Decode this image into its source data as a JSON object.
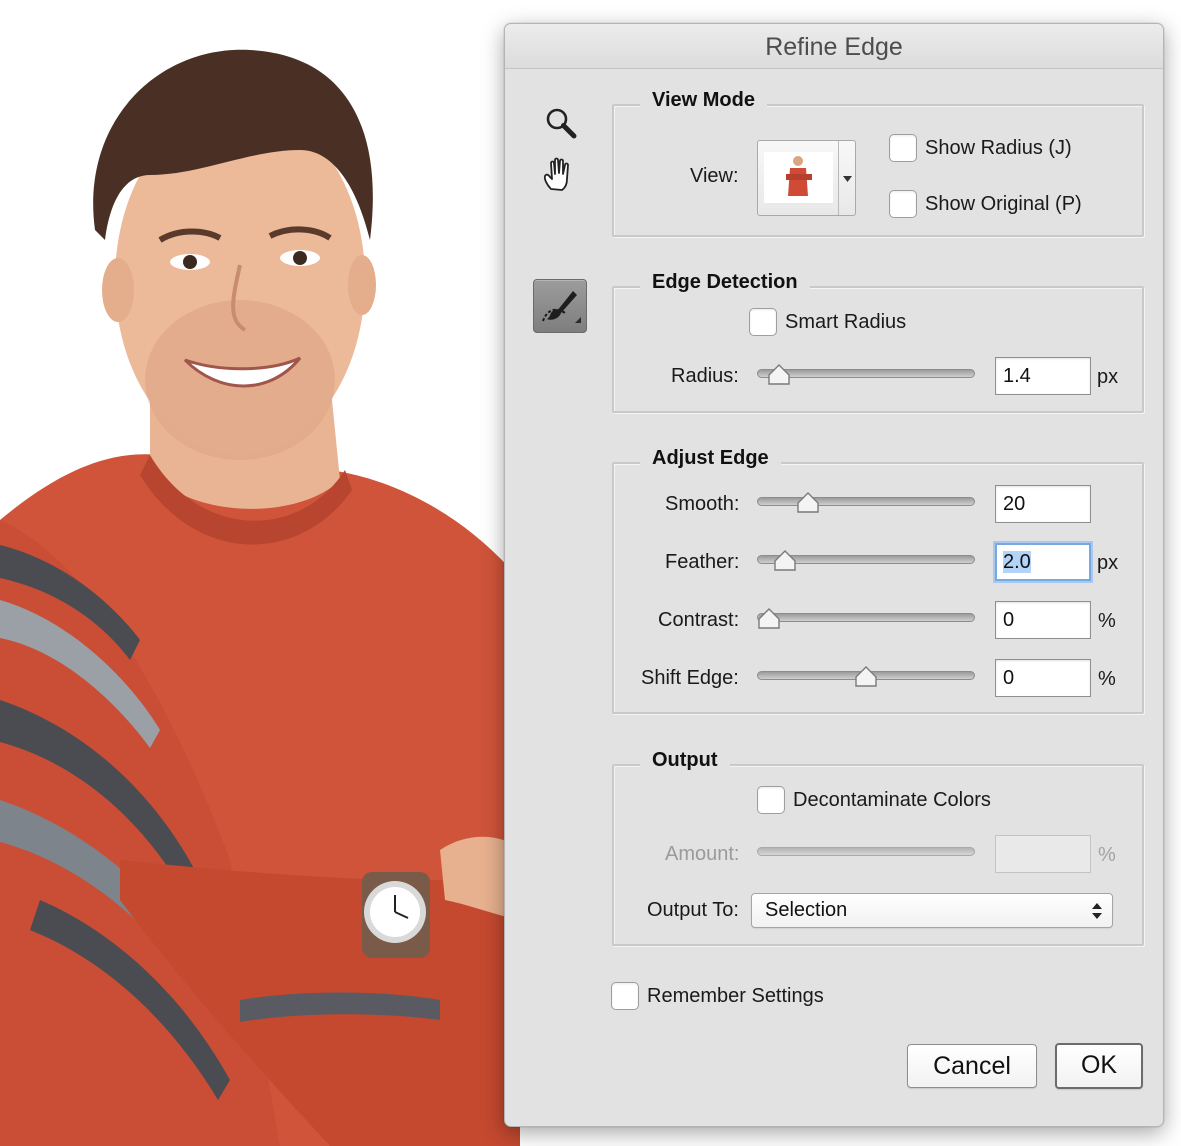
{
  "window": {
    "title": "Refine Edge"
  },
  "tools": {
    "zoom_icon": "magnifier-icon",
    "hand_icon": "hand-icon",
    "refine_brush_icon": "refine-radius-brush-icon"
  },
  "view_mode": {
    "legend": "View Mode",
    "view_label": "View:",
    "show_radius_label": "Show Radius (J)",
    "show_radius_checked": false,
    "show_original_label": "Show Original (P)",
    "show_original_checked": false
  },
  "edge_detection": {
    "legend": "Edge Detection",
    "smart_radius_label": "Smart Radius",
    "smart_radius_checked": false,
    "radius_label": "Radius:",
    "radius_value": "1.4",
    "radius_unit": "px",
    "radius_slider_fraction": 0.05
  },
  "adjust_edge": {
    "legend": "Adjust Edge",
    "smooth_label": "Smooth:",
    "smooth_value": "20",
    "smooth_slider_fraction": 0.2,
    "feather_label": "Feather:",
    "feather_value": "2.0",
    "feather_unit": "px",
    "feather_slider_fraction": 0.08,
    "contrast_label": "Contrast:",
    "contrast_value": "0",
    "contrast_unit": "%",
    "contrast_slider_fraction": 0.0,
    "shift_edge_label": "Shift Edge:",
    "shift_edge_value": "0",
    "shift_edge_unit": "%",
    "shift_edge_slider_fraction": 0.5
  },
  "output": {
    "legend": "Output",
    "decontaminate_label": "Decontaminate Colors",
    "decontaminate_checked": false,
    "amount_label": "Amount:",
    "amount_value": "",
    "amount_unit": "%",
    "output_to_label": "Output To:",
    "output_to_value": "Selection"
  },
  "remember_settings": {
    "label": "Remember Settings",
    "checked": false
  },
  "buttons": {
    "cancel": "Cancel",
    "ok": "OK"
  },
  "colors": {
    "dialog_bg": "#e2e2e2",
    "focus_ring": "#78a8e0",
    "sweater": "#d2553a"
  }
}
